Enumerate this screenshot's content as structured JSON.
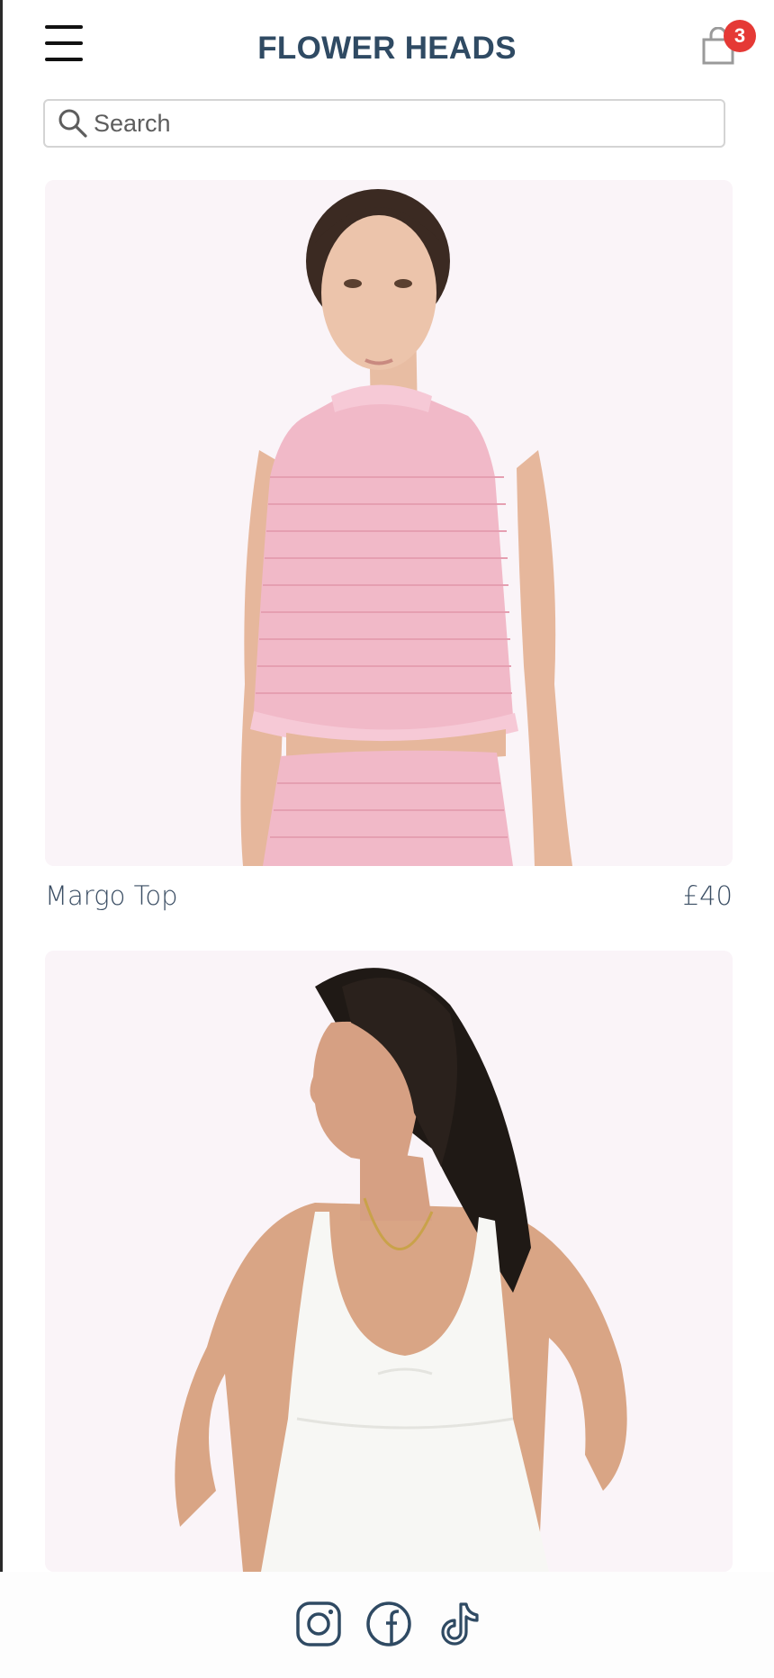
{
  "header": {
    "brand": "FLOWER HEADS",
    "menu_icon": "hamburger-menu-icon",
    "cart_icon": "shopping-bag-icon",
    "cart_count": "3"
  },
  "search": {
    "placeholder": "Search",
    "value": "",
    "icon": "search-icon"
  },
  "products": [
    {
      "name": "Margo Top",
      "price": "£40",
      "image": "model-in-pink-smocked-top-photo"
    },
    {
      "name": "",
      "price": "",
      "image": "model-in-white-sundress-photo"
    }
  ],
  "footer": {
    "social": [
      "instagram-icon",
      "facebook-icon",
      "tiktok-icon"
    ]
  },
  "colors": {
    "brand": "#2f4a63",
    "badge": "#e53935",
    "image_background": "#faf4f8",
    "text": "#3a4d63"
  }
}
